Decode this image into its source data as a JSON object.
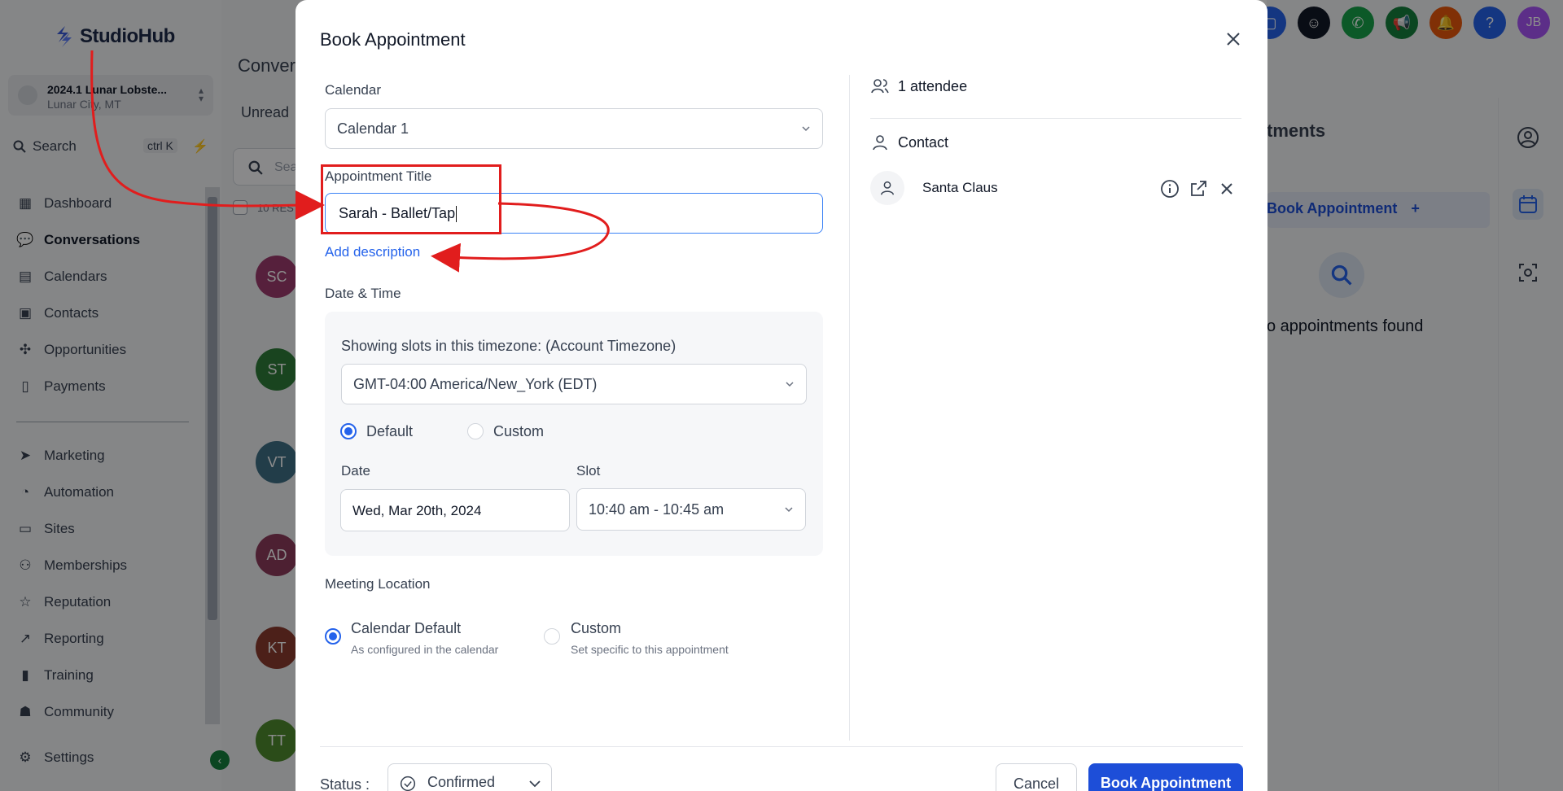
{
  "app": {
    "logo_text": "StudioHub",
    "account_name": "2024.1 Lunar Lobste...",
    "account_location": "Lunar City, MT",
    "search_label": "Search",
    "search_shortcut": "ctrl K"
  },
  "sidebar": {
    "items": [
      {
        "label": "Dashboard",
        "icon": "dashboard-icon"
      },
      {
        "label": "Conversations",
        "icon": "chat-icon"
      },
      {
        "label": "Calendars",
        "icon": "calendar-icon"
      },
      {
        "label": "Contacts",
        "icon": "contacts-icon"
      },
      {
        "label": "Opportunities",
        "icon": "opportunities-icon"
      },
      {
        "label": "Payments",
        "icon": "payments-icon"
      },
      {
        "label": "Marketing",
        "icon": "send-icon"
      },
      {
        "label": "Automation",
        "icon": "automation-icon"
      },
      {
        "label": "Sites",
        "icon": "sites-icon"
      },
      {
        "label": "Memberships",
        "icon": "memberships-icon"
      },
      {
        "label": "Reputation",
        "icon": "star-icon"
      },
      {
        "label": "Reporting",
        "icon": "reporting-icon"
      },
      {
        "label": "Training",
        "icon": "book-icon"
      },
      {
        "label": "Community",
        "icon": "community-icon"
      },
      {
        "label": "Settings",
        "icon": "gear-icon"
      }
    ]
  },
  "conversations": {
    "header": "Conver",
    "tab_unread": "Unread",
    "search_placeholder": "Sea",
    "results_count": "10 RES",
    "avatars": [
      "SC",
      "ST",
      "VT",
      "AD",
      "KT",
      "TT"
    ]
  },
  "right_panel": {
    "title": "tments",
    "book_button": "Book Appointment",
    "empty_text": "o appointments found"
  },
  "topbar": {
    "user_initials": "JB"
  },
  "modal": {
    "title": "Book Appointment",
    "calendar_label": "Calendar",
    "calendar_value": "Calendar 1",
    "appointment_title_label": "Appointment Title",
    "appointment_title_value": "Sarah - Ballet/Tap",
    "add_description": "Add description",
    "date_time_label": "Date & Time",
    "timezone_heading": "Showing slots in this timezone: (Account Timezone)",
    "timezone_value": "GMT-04:00 America/New_York (EDT)",
    "slot_mode_default": "Default",
    "slot_mode_custom": "Custom",
    "date_label": "Date",
    "date_value": "Wed, Mar 20th, 2024",
    "slot_label": "Slot",
    "slot_value": "10:40 am - 10:45 am",
    "meeting_location_label": "Meeting Location",
    "loc_default_title": "Calendar Default",
    "loc_default_sub": "As configured in the calendar",
    "loc_custom_title": "Custom",
    "loc_custom_sub": "Set specific to this appointment",
    "attendee_count": "1 attendee",
    "contact_label": "Contact",
    "contact_name": "Santa Claus",
    "status_label": "Status :",
    "status_value": "Confirmed",
    "cancel_button": "Cancel",
    "book_button": "Book Appointment"
  },
  "colors": {
    "primary": "#1d4ed8",
    "annotation": "#e11d1d"
  }
}
